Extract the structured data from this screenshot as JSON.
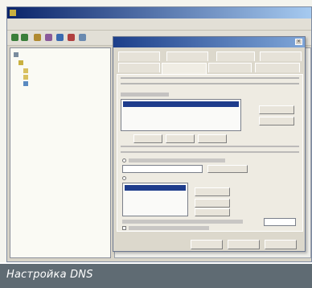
{
  "caption": "Настройка DNS",
  "colors": {
    "titlebar": "#0a246a",
    "selection": "#1e3c8c",
    "caption_bg": "#5f6b73"
  },
  "mmc": {
    "menu": [
      "",
      "",
      "",
      "",
      ""
    ],
    "toolbar_icons": [
      "back-icon",
      "forward-icon",
      "up-icon",
      "properties-icon",
      "refresh-icon",
      "export-icon",
      "help-icon"
    ],
    "tree": [
      {
        "icon": "console-root-icon"
      },
      {
        "icon": "folder-icon"
      },
      {
        "icon": "folder-icon"
      },
      {
        "icon": "computer-icon"
      }
    ]
  },
  "dialog": {
    "tabs": [
      "",
      "",
      "",
      "",
      "",
      "",
      "",
      ""
    ],
    "dns_server_list_selected": "",
    "suffix_list_selected": ""
  }
}
